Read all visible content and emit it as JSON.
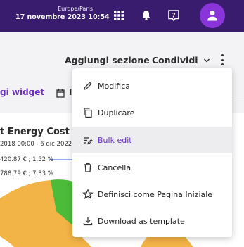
{
  "header": {
    "timezone": "Europe/Paris",
    "datetime": "17 novembre 2023 10:54",
    "bg_color": "#3a1c6e",
    "icons": [
      "apps-grid-icon",
      "bell-icon",
      "help-icon"
    ],
    "avatar_icon": "user-icon",
    "avatar_color": "#8a35d9"
  },
  "toolbar": {
    "add_section": "Aggiungi sezione",
    "share": "Condividi",
    "share_icon": "chevron-down-icon",
    "more_icon": "kebab-menu-icon"
  },
  "subtoolbar": {
    "widget_link": "gi widget",
    "calendar_icon": "calendar-icon",
    "partial_label": "I"
  },
  "chart_bg": {
    "title": "t Energy Cost spl",
    "range": "2018 00:00 - 6 dic 2022",
    "legend": [
      {
        "label": "420.87 € ; 1.52 %",
        "color": "#3b5bd9"
      },
      {
        "label": "788.79 € ; 7.33 %",
        "color": "#4cbb3a"
      }
    ]
  },
  "menu": {
    "items": [
      {
        "label": "Modifica",
        "icon": "pencil-icon"
      },
      {
        "label": "Duplicare",
        "icon": "copy-icon"
      },
      {
        "label": "Bulk edit",
        "icon": "bulk-edit-icon",
        "active": true
      },
      {
        "label": "Cancella",
        "icon": "trash-icon"
      },
      {
        "label": "Definisci come Pagina Iniziale",
        "icon": "star-icon"
      },
      {
        "label": "Download as template",
        "icon": "download-icon"
      }
    ],
    "accent_color": "#6b2fc0"
  }
}
